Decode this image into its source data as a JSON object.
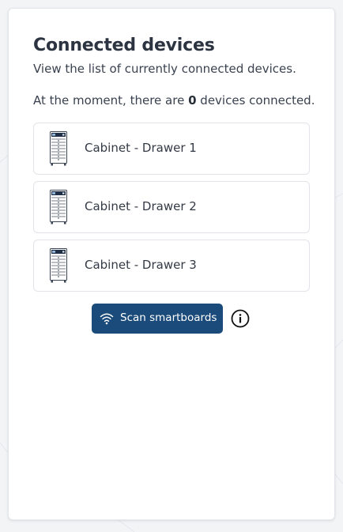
{
  "header": {
    "title": "Connected devices",
    "subtitle": "View the list of currently connected devices."
  },
  "status": {
    "prefix": "At the moment, there are",
    "count": "0",
    "suffix": "devices connected."
  },
  "devices": [
    {
      "label": "Cabinet - Drawer 1",
      "icon": "cabinet-icon"
    },
    {
      "label": "Cabinet - Drawer 2",
      "icon": "cabinet-icon"
    },
    {
      "label": "Cabinet - Drawer 3",
      "icon": "cabinet-icon"
    }
  ],
  "actions": {
    "scan_label": "Scan smartboards",
    "scan_icon": "wifi-icon",
    "info_icon": "info-icon"
  },
  "colors": {
    "primary_button": "#1b4b7a",
    "card_background": "#ffffff",
    "page_background": "#f3f4f6"
  }
}
